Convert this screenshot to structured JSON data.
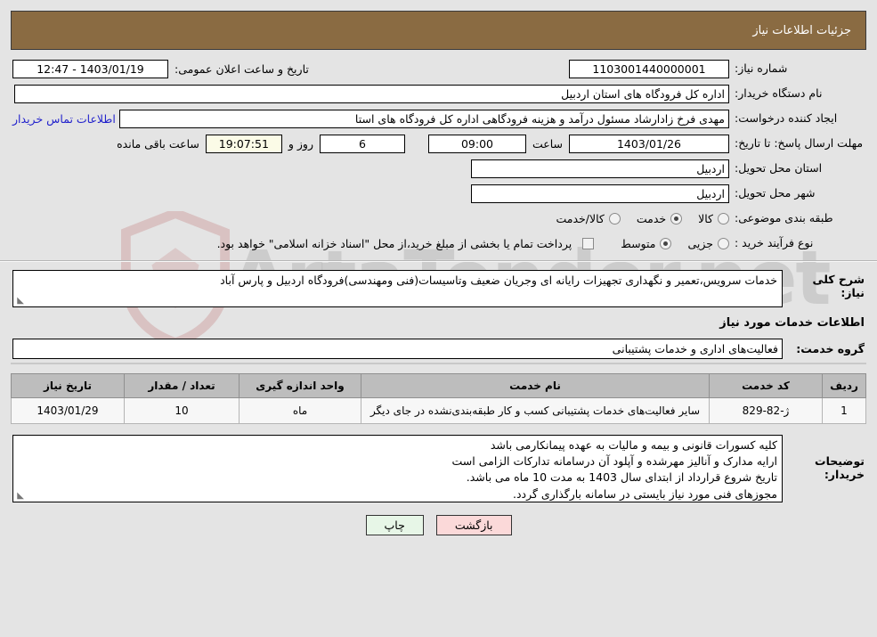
{
  "header": {
    "title": "جزئیات اطلاعات نیاز",
    "bg_color": "#8a6b42"
  },
  "watermark": {
    "text": "ArtaTender.net"
  },
  "fields": {
    "need_number_label": "شماره نیاز:",
    "need_number_value": "1103001440000001",
    "public_announce_label": "تاریخ و ساعت اعلان عمومی:",
    "public_announce_value": "1403/01/19 - 12:47",
    "buyer_org_label": "نام دستگاه خریدار:",
    "buyer_org_value": "اداره کل فرودگاه های استان اردبیل",
    "creator_label": "ایجاد کننده درخواست:",
    "creator_value": "مهدی فرخ زادارشاد مسئول درآمد و هزینه فرودگاهی اداره کل فرودگاه های استا",
    "buyer_contact_link": "اطلاعات تماس خریدار",
    "deadline_label": "مهلت ارسال پاسخ: تا تاریخ:",
    "deadline_date": "1403/01/26",
    "hour_label": "ساعت",
    "deadline_time": "09:00",
    "days_remaining": "6",
    "days_and_label": "روز و",
    "time_remaining": "19:07:51",
    "remaining_suffix": "ساعت باقی مانده",
    "delivery_province_label": "استان محل تحویل:",
    "delivery_province_value": "اردبیل",
    "delivery_city_label": "شهر محل تحویل:",
    "delivery_city_value": "اردبیل",
    "subject_class_label": "طبقه بندی موضوعی:",
    "purchase_type_label": "نوع فرآیند خرید :",
    "treasury_note": "پرداخت تمام یا بخشی از مبلغ خرید،از محل \"اسناد خزانه اسلامی\" خواهد بود."
  },
  "subject_options": [
    {
      "label": "کالا",
      "checked": false
    },
    {
      "label": "خدمت",
      "checked": true
    },
    {
      "label": "کالا/خدمت",
      "checked": false
    }
  ],
  "purchase_options": [
    {
      "label": "جزیی",
      "checked": false
    },
    {
      "label": "متوسط",
      "checked": true
    }
  ],
  "description": {
    "label": "شرح کلی نیاز:",
    "value": "خدمات سرویس،تعمیر و نگهداری تجهیزات رایانه ای وجریان ضعیف وتاسیسات(فنی ومهندسی)فرودگاه اردبیل و پارس آباد"
  },
  "services_section": {
    "heading": "اطلاعات خدمات مورد نیاز",
    "group_label": "گروه خدمت:",
    "group_value": "فعالیت‌های اداری و خدمات پشتیبانی"
  },
  "table": {
    "headers": [
      "ردیف",
      "کد خدمت",
      "نام خدمت",
      "واحد اندازه گیری",
      "تعداد / مقدار",
      "تاریخ نیاز"
    ],
    "rows": [
      {
        "index": "1",
        "code": "ژ-82-829",
        "name": "سایر فعالیت‌های خدمات پشتیبانی کسب و کار طبقه‌بندی‌نشده در جای دیگر",
        "unit": "ماه",
        "quantity": "10",
        "need_date": "1403/01/29"
      }
    ]
  },
  "buyer_notes": {
    "label": "توضیحات خریدار:",
    "lines": [
      "کلیه کسورات قانونی و بیمه و مالیات به عهده پیمانکارمی باشد",
      "ارایه مدارک و آنالیز مهرشده و آپلود آن درسامانه تدارکات الزامی است",
      "تاریخ شروع قرارداد از ابتدای سال 1403 به مدت 10 ماه می باشد.",
      "مجوزهای فنی مورد نیاز بایستی در سامانه بارگذاری گردد."
    ]
  },
  "buttons": {
    "print": "چاپ",
    "back": "بازگشت"
  }
}
